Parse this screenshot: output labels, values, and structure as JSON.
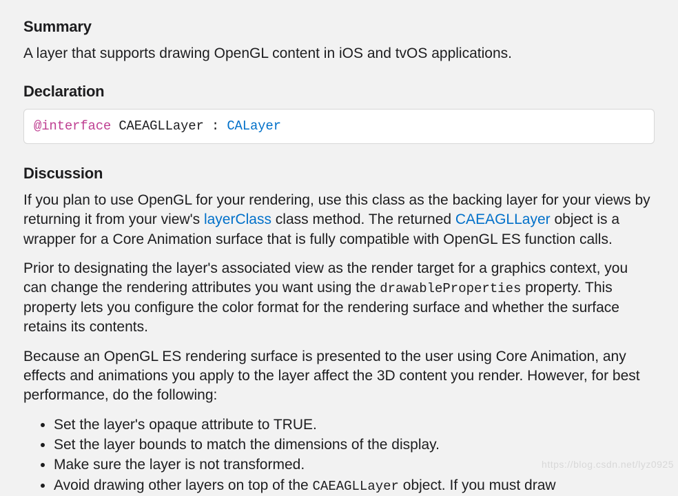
{
  "summary": {
    "heading": "Summary",
    "text": "A layer that supports drawing OpenGL content in iOS and tvOS applications."
  },
  "declaration": {
    "heading": "Declaration",
    "keyword": "@interface",
    "mid": " CAEAGLLayer : ",
    "super": "CALayer"
  },
  "discussion": {
    "heading": "Discussion",
    "p1a": "If you plan to use OpenGL for your rendering, use this class as the backing layer for your views by returning it from your view's ",
    "p1_link1": "layerClass",
    "p1b": " class method. The returned ",
    "p1_link2": "CAEAGLLayer",
    "p1c": " object is a wrapper for a Core Animation surface that is fully compatible with OpenGL ES function calls.",
    "p2a": "Prior to designating the layer's associated view as the render target for a graphics context, you can change the rendering attributes you want using the ",
    "p2_code": "drawableProperties",
    "p2b": " property. This property lets you configure the color format for the rendering surface and whether the surface retains its contents.",
    "p3": "Because an OpenGL ES rendering surface is presented to the user using Core Animation, any effects and animations you apply to the layer affect the 3D content you render. However, for best performance, do the following:",
    "bullets": {
      "b1": "Set the layer's opaque attribute to TRUE.",
      "b2": "Set the layer bounds to match the dimensions of the display.",
      "b3": "Make sure the layer is not transformed.",
      "b4a": "Avoid drawing other layers on top of the ",
      "b4_code": "CAEAGLLayer",
      "b4b": " object. If you must draw"
    }
  },
  "watermark": "https://blog.csdn.net/lyz0925"
}
